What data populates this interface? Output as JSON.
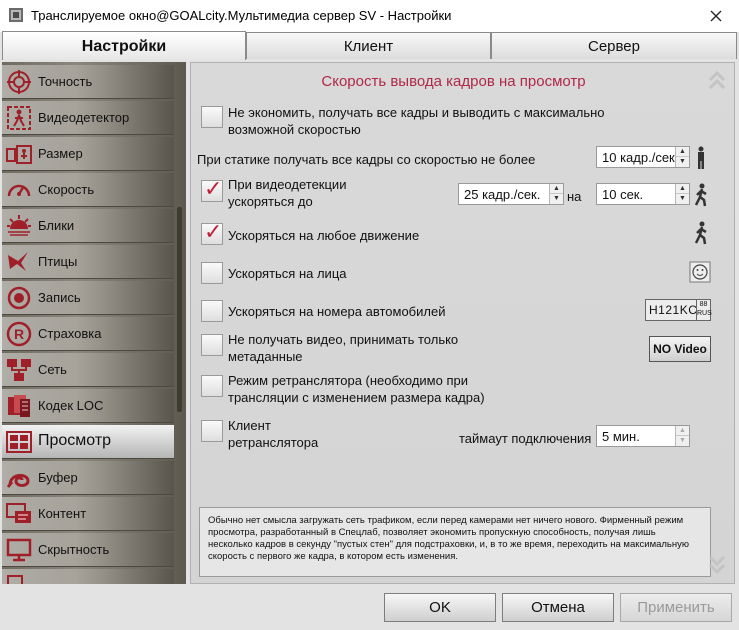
{
  "window": {
    "title": "Транслируемое окно@GOALcity.Мультимедиа сервер SV - Настройки"
  },
  "tabs": [
    {
      "label": "Настройки",
      "active": true
    },
    {
      "label": "Клиент",
      "active": false
    },
    {
      "label": "Сервер",
      "active": false
    }
  ],
  "sidebar": {
    "items": [
      {
        "label": "Точность",
        "icon": "precision-icon"
      },
      {
        "label": "Видеодетектор",
        "icon": "video-detector-icon"
      },
      {
        "label": "Размер",
        "icon": "size-icon"
      },
      {
        "label": "Скорость",
        "icon": "speedometer-icon"
      },
      {
        "label": "Блики",
        "icon": "glare-icon"
      },
      {
        "label": "Птицы",
        "icon": "birds-icon"
      },
      {
        "label": "Запись",
        "icon": "record-icon"
      },
      {
        "label": "Страховка",
        "icon": "insurance-icon"
      },
      {
        "label": "Сеть",
        "icon": "network-icon"
      },
      {
        "label": "Кодек LOC",
        "icon": "codec-icon"
      },
      {
        "label": "Просмотр",
        "icon": "view-icon",
        "active": true
      },
      {
        "label": "Буфер",
        "icon": "buffer-icon"
      },
      {
        "label": "Контент",
        "icon": "content-icon"
      },
      {
        "label": "Скрытность",
        "icon": "stealth-icon"
      }
    ]
  },
  "main": {
    "heading": "Скорость вывода кадров на просмотр",
    "options": {
      "no_economy": {
        "line1": "Не экономить, получать все кадры и выводить с максимально",
        "line2": "возможной скоростью",
        "checked": false
      },
      "static": {
        "label": "При статике получать все кадры со скоростью не более",
        "value": "10 кадр./сек"
      },
      "detection": {
        "line1": "При видеодетекции",
        "line2": "ускоряться до",
        "checked": true,
        "rate": "25 кадр./сек.",
        "on": "на",
        "duration": "10 сек."
      },
      "any_motion": {
        "label": "Ускоряться на любое движение",
        "checked": true
      },
      "faces": {
        "label": "Ускоряться на лица",
        "checked": false
      },
      "plates": {
        "label": "Ускоряться на номера автомобилей",
        "checked": false,
        "plate_text": "H121KC",
        "plate_region_top": "88",
        "plate_region_bottom": "RUS"
      },
      "no_video": {
        "line1": "Не получать видео, принимать только",
        "line2": "метаданные",
        "checked": false,
        "badge": "NO Video"
      },
      "relay_mode": {
        "line1": "Режим ретранслятора (необходимо при",
        "line2": "трансляции с изменением размера кадра)",
        "checked": false
      },
      "relay_client": {
        "line1": "Клиент",
        "line2": "ретранслятора",
        "checked": false,
        "timeout_label": "таймаут подключения",
        "timeout_value": "5 мин."
      }
    },
    "info": "Обычно нет смысла загружать сеть трафиком, если перед камерами нет ничего нового. Фирменный режим просмотра, разработанный в Спецлаб, позволяет экономить пропускную способность, получая лишь несколько кадров в секунду \"пустых стен\" для подстраховки, и, в то же время, переходить на максимальную скорость с первого же кадра, в котором есть изменения."
  },
  "buttons": {
    "ok": "OK",
    "cancel": "Отмена",
    "apply": "Применить"
  },
  "colors": {
    "accent": "#b02848",
    "check": "#c0203a",
    "sidebar_bg": "#7a766b"
  }
}
